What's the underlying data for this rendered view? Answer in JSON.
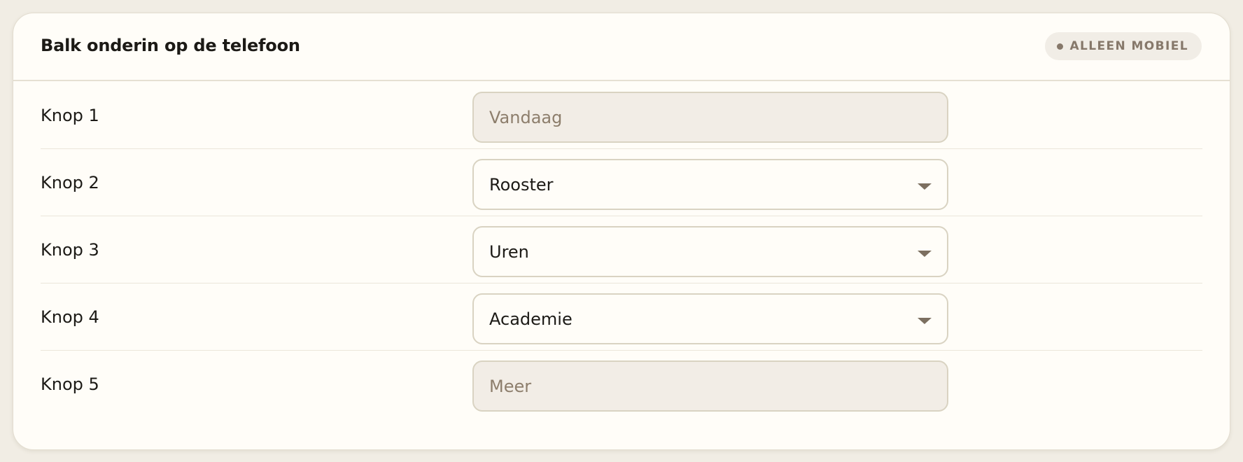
{
  "panel": {
    "title": "Balk onderin op de telefoon",
    "badge": "ALLEEN MOBIEL"
  },
  "rows": [
    {
      "label": "Knop 1",
      "value": "Vandaag",
      "kind": "locked"
    },
    {
      "label": "Knop 2",
      "value": "Rooster",
      "kind": "select"
    },
    {
      "label": "Knop 3",
      "value": "Uren",
      "kind": "select"
    },
    {
      "label": "Knop 4",
      "value": "Academie",
      "kind": "select"
    },
    {
      "label": "Knop 5",
      "value": "Meer",
      "kind": "locked"
    }
  ],
  "icons": {
    "badge_dot": "dot-icon",
    "dropdown": "chevron-down-icon"
  },
  "colors": {
    "background": "#f1ede4",
    "card": "#fffdf8",
    "locked_field_bg": "#f2ede6",
    "muted_text": "#8d7e6c",
    "badge_text": "#86786a"
  }
}
